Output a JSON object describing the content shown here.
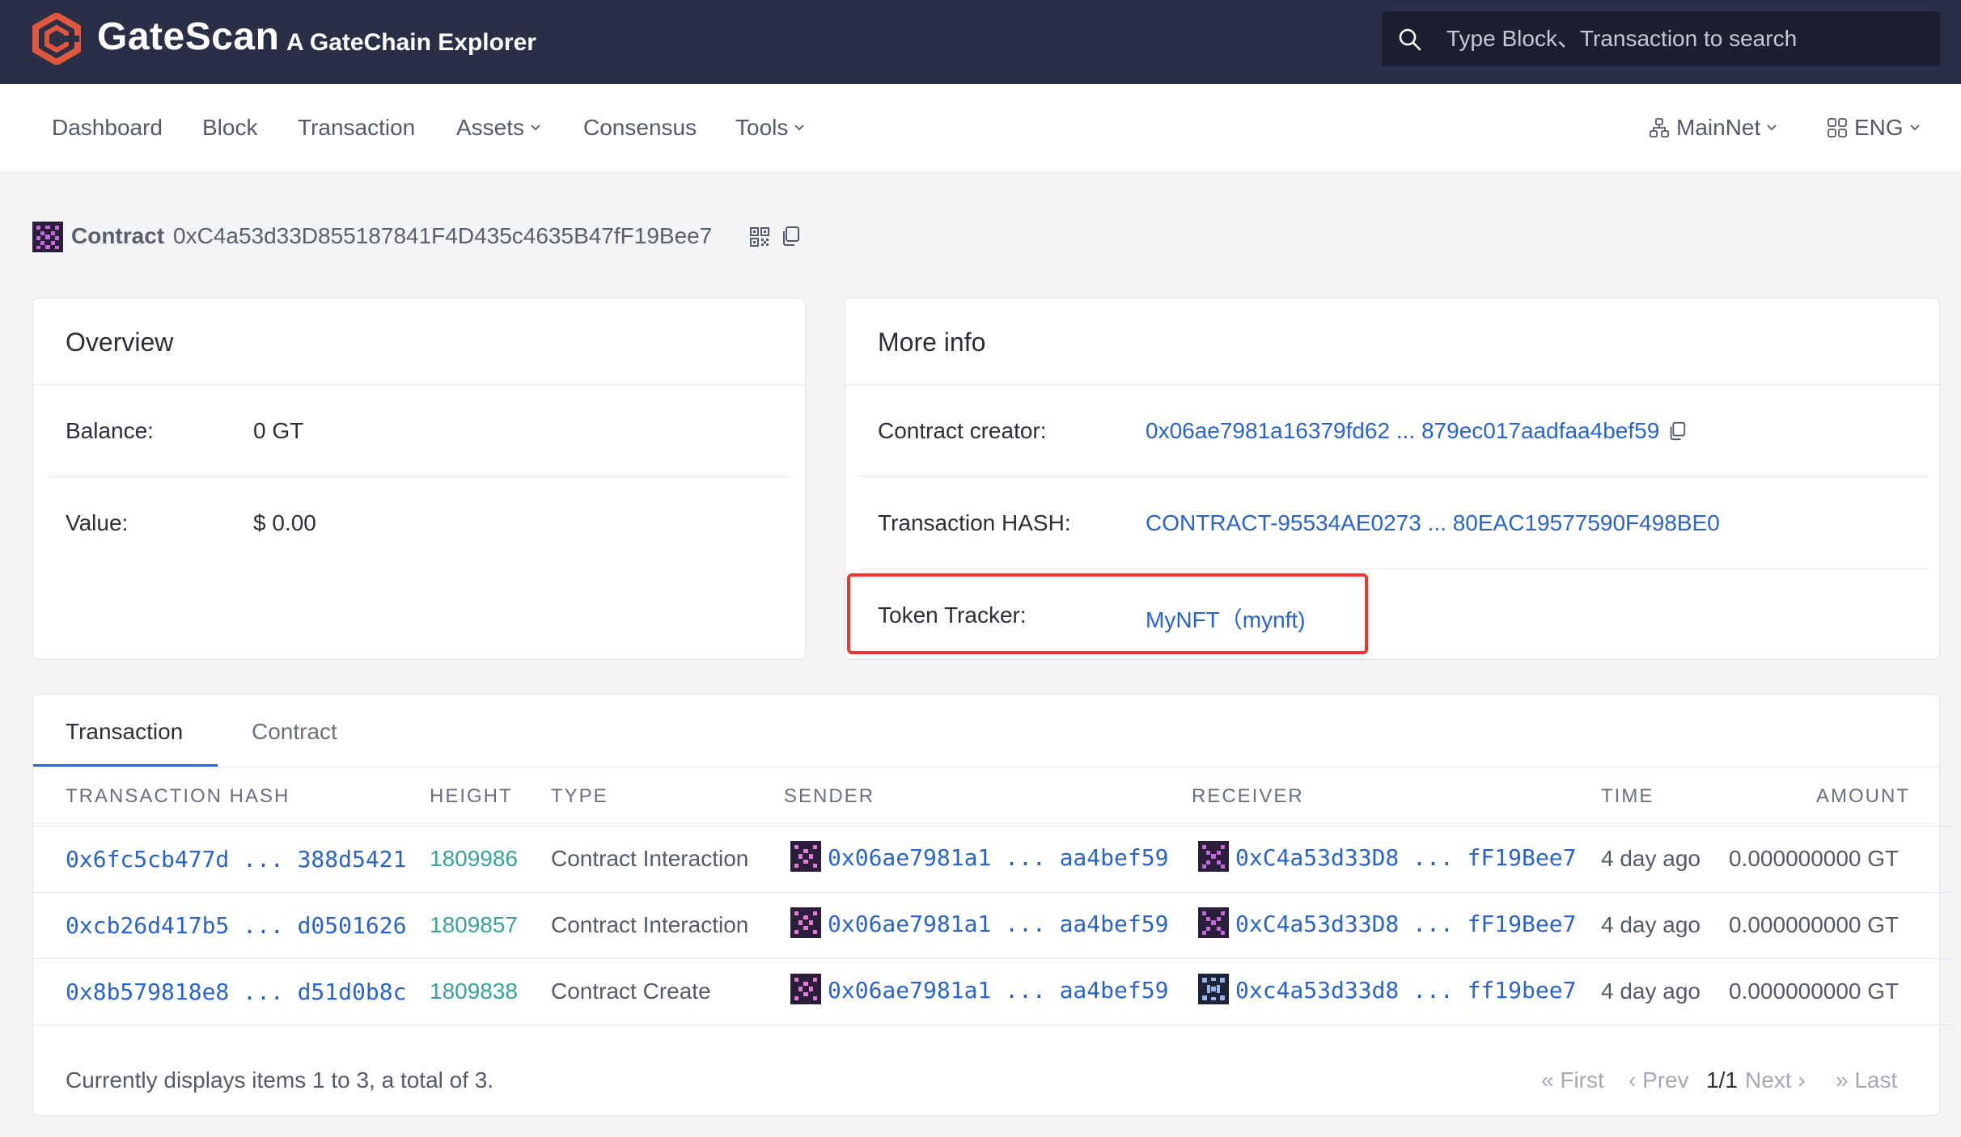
{
  "header": {
    "brand_name": "GateScan",
    "brand_sub": "A GateChain Explorer",
    "search_placeholder": "Type Block、Transaction to search"
  },
  "nav": {
    "items": [
      "Dashboard",
      "Block",
      "Transaction",
      "Assets",
      "Consensus",
      "Tools"
    ],
    "network": "MainNet",
    "language": "ENG"
  },
  "contract": {
    "label": "Contract",
    "address": "0xC4a53d33D855187841F4D435c4635B47fF19Bee7"
  },
  "overview": {
    "title": "Overview",
    "balance_label": "Balance:",
    "balance_value": "0 GT",
    "value_label": "Value:",
    "value_value": "$ 0.00"
  },
  "more_info": {
    "title": "More info",
    "creator_label": "Contract creator:",
    "creator_value": "0x06ae7981a16379fd62 ... 879ec017aadfaa4bef59",
    "tx_hash_label": "Transaction HASH:",
    "tx_hash_value": "CONTRACT-95534AE0273 ... 80EAC19577590F498BE0",
    "token_tracker_label": "Token Tracker:",
    "token_tracker_value": "MyNFT（mynft)"
  },
  "tabs": [
    "Transaction",
    "Contract"
  ],
  "table": {
    "columns": [
      "TRANSACTION HASH",
      "HEIGHT",
      "TYPE",
      "SENDER",
      "RECEIVER",
      "TIME",
      "AMOUNT"
    ],
    "rows": [
      {
        "hash": "0x6fc5cb477d ... 388d5421",
        "height": "1809986",
        "type": "Contract Interaction",
        "sender": "0x06ae7981a1 ... aa4bef59",
        "receiver": "0xC4a53d33D8 ... fF19Bee7",
        "time": "4 day ago",
        "amount": "0.000000000 GT"
      },
      {
        "hash": "0xcb26d417b5 ... d0501626",
        "height": "1809857",
        "type": "Contract Interaction",
        "sender": "0x06ae7981a1 ... aa4bef59",
        "receiver": "0xC4a53d33D8 ... fF19Bee7",
        "time": "4 day ago",
        "amount": "0.000000000 GT"
      },
      {
        "hash": "0x8b579818e8 ... d51d0b8c",
        "height": "1809838",
        "type": "Contract Create",
        "sender": "0x06ae7981a1 ... aa4bef59",
        "receiver": "0xc4a53d33d8 ... ff19bee7",
        "time": "4 day ago",
        "amount": "0.000000000 GT"
      }
    ]
  },
  "pagination": {
    "summary": "Currently displays items 1 to 3, a total of 3.",
    "first": "« First",
    "prev": "‹ Prev",
    "current": "1/1",
    "next": "Next ›",
    "last": "» Last"
  },
  "colors": {
    "header_bg": "#2a2f45",
    "link": "#2a64c8",
    "height_link": "#38a39a",
    "highlight": "#e23d2e",
    "brand_accent": "#e0573f"
  }
}
